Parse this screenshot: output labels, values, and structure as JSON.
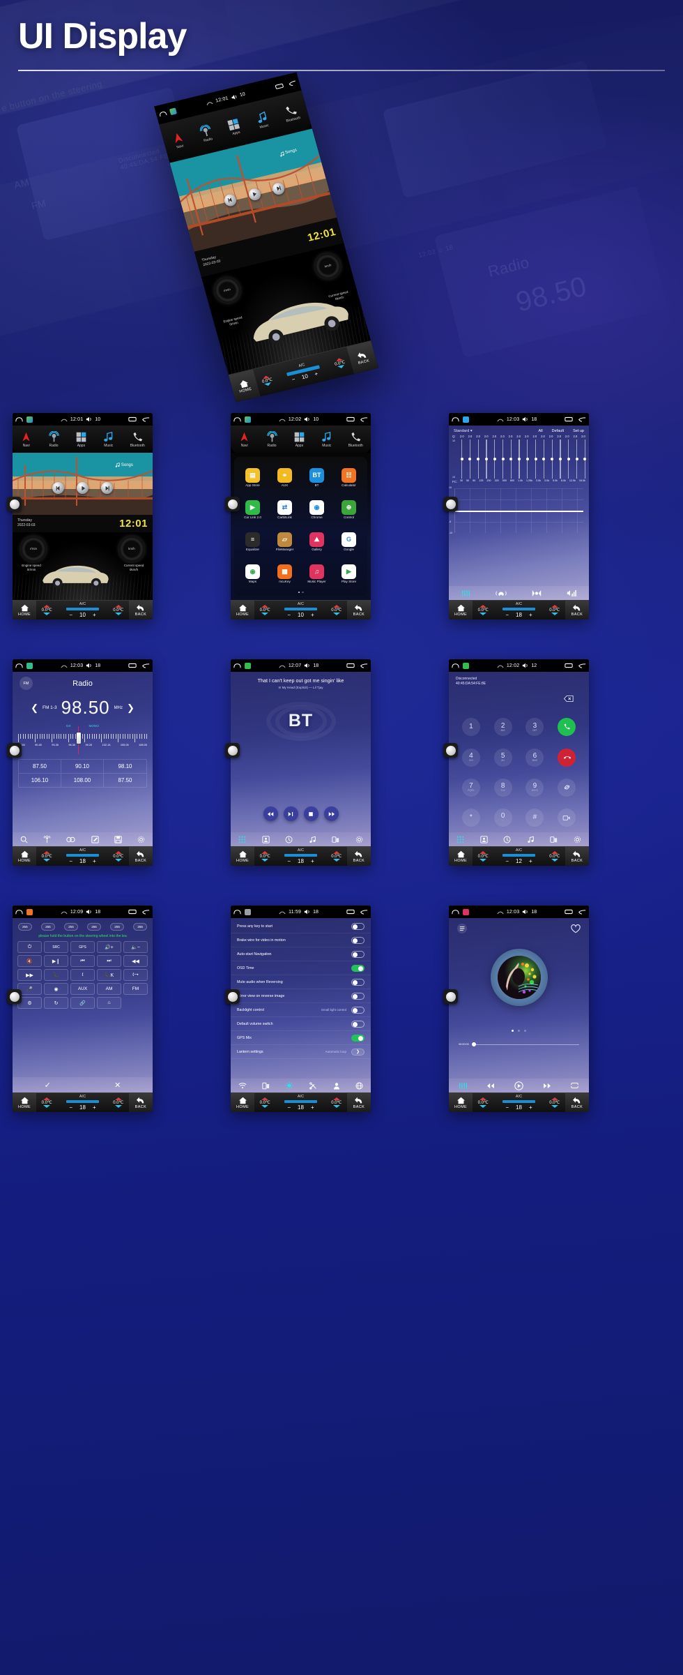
{
  "page": {
    "title": "UI Display"
  },
  "hero": {
    "statusbar": {
      "time": "12:01",
      "volume": "10"
    },
    "topnav": [
      {
        "label": "Navi",
        "icon": "navigation-arrow-icon"
      },
      {
        "label": "Radio",
        "icon": "radio-antenna-icon"
      },
      {
        "label": "Apps",
        "icon": "apps-grid-icon"
      },
      {
        "label": "Music",
        "icon": "music-note-icon"
      },
      {
        "label": "Bluetooth",
        "icon": "phone-handset-icon"
      }
    ],
    "songs_label": "Songs",
    "day": "Thursday",
    "date": "2022-03-03",
    "clock": "12:01",
    "gauge_left": {
      "unit": "r/min",
      "caption": "Engine speed",
      "value": "0r/min"
    },
    "gauge_right": {
      "unit": "km/h",
      "caption": "Current speed",
      "value": "0km/h"
    },
    "climate": {
      "home": "HOME",
      "back": "BACK",
      "ac": "A/C",
      "temp_left": "0.0℃",
      "temp_right": "0.0℃",
      "fan": "0",
      "volume": "10"
    }
  },
  "climate_common": {
    "home": "HOME",
    "back": "BACK",
    "ac": "A/C",
    "temp_left": "0.0℃",
    "temp_right": "0.0℃",
    "fan": "0"
  },
  "cards": {
    "home": {
      "statusbar": {
        "time": "12:01",
        "volume": "10"
      },
      "topnav": [
        {
          "label": "Navi"
        },
        {
          "label": "Radio"
        },
        {
          "label": "Apps"
        },
        {
          "label": "Music"
        },
        {
          "label": "Bluetooth"
        }
      ],
      "songs_label": "Songs",
      "day": "Thursday",
      "date": "2022-03-03",
      "clock": "12:01",
      "gauge_left": {
        "unit": "r/min",
        "caption": "Engine speed",
        "value": "0r/min"
      },
      "gauge_right": {
        "unit": "km/h",
        "caption": "Current speed",
        "value": "0km/h"
      },
      "climate_volume": "10"
    },
    "apps": {
      "statusbar": {
        "time": "12:02",
        "volume": "10"
      },
      "topnav": [
        {
          "label": "Navi"
        },
        {
          "label": "Radio"
        },
        {
          "label": "Apps"
        },
        {
          "label": "Music"
        },
        {
          "label": "Bluetooth"
        }
      ],
      "items": [
        {
          "name": "App Store",
          "glyph": "▤",
          "bg": "#f5c12b",
          "fg": "#ffffff"
        },
        {
          "name": "AUX",
          "glyph": "⚭",
          "bg": "#f5b921",
          "fg": "#ffffff"
        },
        {
          "name": "BT",
          "glyph": "BT",
          "bg": "#1d8fe0",
          "fg": "#ffffff"
        },
        {
          "name": "Calculator",
          "glyph": "☷",
          "bg": "#ef7424",
          "fg": "#ffffff"
        },
        {
          "name": "Car Link 2.0",
          "glyph": "▶",
          "bg": "#30bb46",
          "fg": "#ffffff"
        },
        {
          "name": "CarbitLink",
          "glyph": "⇄",
          "bg": "#ffffff",
          "fg": "#2a7fd4"
        },
        {
          "name": "Chrome",
          "glyph": "◉",
          "bg": "#ffffff",
          "fg": "#1d8fe0"
        },
        {
          "name": "Control",
          "glyph": "⊕",
          "bg": "#3aa53a",
          "fg": "#ffffff"
        },
        {
          "name": "Equalizer",
          "glyph": "≡",
          "bg": "#2b2b2b",
          "fg": "#ffffff"
        },
        {
          "name": "FileManager",
          "glyph": "▱",
          "bg": "#c08a3e",
          "fg": "#ffffff"
        },
        {
          "name": "Gallery",
          "glyph": "⛰",
          "bg": "#e0335f",
          "fg": "#ffffff"
        },
        {
          "name": "Google",
          "glyph": "G",
          "bg": "#ffffff",
          "fg": "#4285f4"
        },
        {
          "name": "Maps",
          "glyph": "◉",
          "bg": "#ffffff",
          "fg": "#34a853"
        },
        {
          "name": "mcuKey",
          "glyph": "▦",
          "bg": "#f07020",
          "fg": "#ffffff"
        },
        {
          "name": "Music Player",
          "glyph": "♫",
          "bg": "#e0335f",
          "fg": "#ffffff"
        },
        {
          "name": "Play Store",
          "glyph": "▶",
          "bg": "#ffffff",
          "fg": "#34a853"
        }
      ],
      "climate_volume": "10"
    },
    "equalizer": {
      "statusbar": {
        "time": "12:03",
        "volume": "18"
      },
      "preset": "Standard",
      "buttons": [
        "All",
        "Default",
        "Set up"
      ],
      "q_label": "Q:",
      "q_values": [
        "2.0",
        "2.0",
        "2.0",
        "2.0",
        "2.0",
        "2.0",
        "2.0",
        "2.0",
        "2.0",
        "2.0",
        "2.0",
        "2.0",
        "2.0",
        "2.0",
        "2.0",
        "2.0"
      ],
      "fc_label": "FC:",
      "fc_values": [
        "30",
        "50",
        "80",
        "125",
        "200",
        "320",
        "500",
        "800",
        "1.0k",
        "1.25k",
        "2.0k",
        "3.0k",
        "5.0k",
        "8.0k",
        "12.0k",
        "16.0k"
      ],
      "scale_top": "10",
      "scale_bottom": "10",
      "chart_y": [
        "10",
        "5",
        "0",
        "-5",
        "-10"
      ],
      "climate_volume": "18"
    },
    "radio": {
      "statusbar": {
        "time": "12:03",
        "volume": "18"
      },
      "band_badge": "FM",
      "title": "Radio",
      "band": "FM 1-3",
      "frequency": "98.50",
      "unit": "MHz",
      "dx": "DX",
      "mono": "MONO",
      "scale": [
        "87.50",
        "90.45",
        "93.35",
        "96.30",
        "99.20",
        "102.15",
        "105.05",
        "108.00"
      ],
      "presets": [
        "87.50",
        "90.10",
        "98.10",
        "106.10",
        "108.00",
        "87.50"
      ],
      "climate_volume": "18"
    },
    "bluetooth_music": {
      "statusbar": {
        "time": "12:07",
        "volume": "18"
      },
      "lyric": "That I can't keep out got me singin' like",
      "track": "In My Head (Explicit) — Lil Tjay",
      "logo": "BT",
      "climate_volume": "18"
    },
    "dialpad": {
      "statusbar": {
        "time": "12:02",
        "volume": "12"
      },
      "status": "Disconnected",
      "mac": "40:45:DA:54:FE:8E",
      "keys": [
        {
          "n": "1",
          "a": ""
        },
        {
          "n": "2",
          "a": "ABC"
        },
        {
          "n": "3",
          "a": "DEF"
        },
        {
          "n": "4",
          "a": "GHI"
        },
        {
          "n": "5",
          "a": "JKL"
        },
        {
          "n": "6",
          "a": "MNO"
        },
        {
          "n": "7",
          "a": "PQRS"
        },
        {
          "n": "8",
          "a": "TUV"
        },
        {
          "n": "9",
          "a": "WXYZ"
        },
        {
          "n": "*",
          "a": ""
        },
        {
          "n": "0",
          "a": "+"
        },
        {
          "n": "#",
          "a": ""
        }
      ],
      "climate_volume": "12"
    },
    "steering": {
      "statusbar": {
        "time": "12:09",
        "volume": "18"
      },
      "pills": [
        "255",
        "255",
        "255",
        "255",
        "255",
        "255"
      ],
      "hint": "please hold the button on the steering wheel into the lea",
      "keys": [
        "power-icon",
        "src-icon",
        "gps-icon",
        "volume-up-icon",
        "volume-down-icon",
        "mute-icon",
        "play-pause-icon",
        "previous-track-icon",
        "next-track-icon",
        "rewind-icon",
        "fast-forward-icon",
        "call-answer-icon",
        "call-end-icon",
        "call-key-icon",
        "call-switch-icon",
        "microphone-icon",
        "camera-icon",
        "AUX",
        "AM",
        "FM",
        "settings-gear-icon",
        "360-view-icon",
        "bluetooth-icon",
        "home-icon"
      ],
      "confirm": "✓",
      "cancel": "✕",
      "climate_volume": "18"
    },
    "settings": {
      "statusbar": {
        "time": "11:59",
        "volume": "18"
      },
      "rows": [
        {
          "label": "Press any key to start",
          "value": "",
          "state": "off"
        },
        {
          "label": "Brake wire for video in motion",
          "value": "",
          "state": "off"
        },
        {
          "label": "Auto-start Navigation",
          "value": "",
          "state": "off"
        },
        {
          "label": "OSD Time",
          "value": "",
          "state": "on"
        },
        {
          "label": "Mute audio when Reversing",
          "value": "",
          "state": "off"
        },
        {
          "label": "Mirror view on reverse image",
          "value": "",
          "state": "off"
        },
        {
          "label": "Backlight control",
          "value": "Small light control",
          "state": "off"
        },
        {
          "label": "Default volume switch",
          "value": "",
          "state": "off"
        },
        {
          "label": "GPS Mix",
          "value": "",
          "state": "on"
        },
        {
          "label": "Lantern settings",
          "value": "Automatic loop",
          "state": "arrow"
        }
      ],
      "toolbar": [
        "wifi-icon",
        "device-icon",
        "brightness-icon",
        "tools-icon",
        "user-icon",
        "globe-icon"
      ],
      "climate_volume": "18"
    },
    "music_player": {
      "statusbar": {
        "time": "12:03",
        "volume": "18"
      },
      "elapsed": "00:00:00",
      "climate_volume": "18"
    }
  },
  "colors": {
    "accent_cyan": "#34d4e8",
    "accent_yellow": "#f2e33a",
    "toggle_on": "#25c05a",
    "hint_green": "#2ee05a",
    "call_green": "#1fbf52",
    "call_red": "#cf2233",
    "bg_deep": "#151a62"
  }
}
